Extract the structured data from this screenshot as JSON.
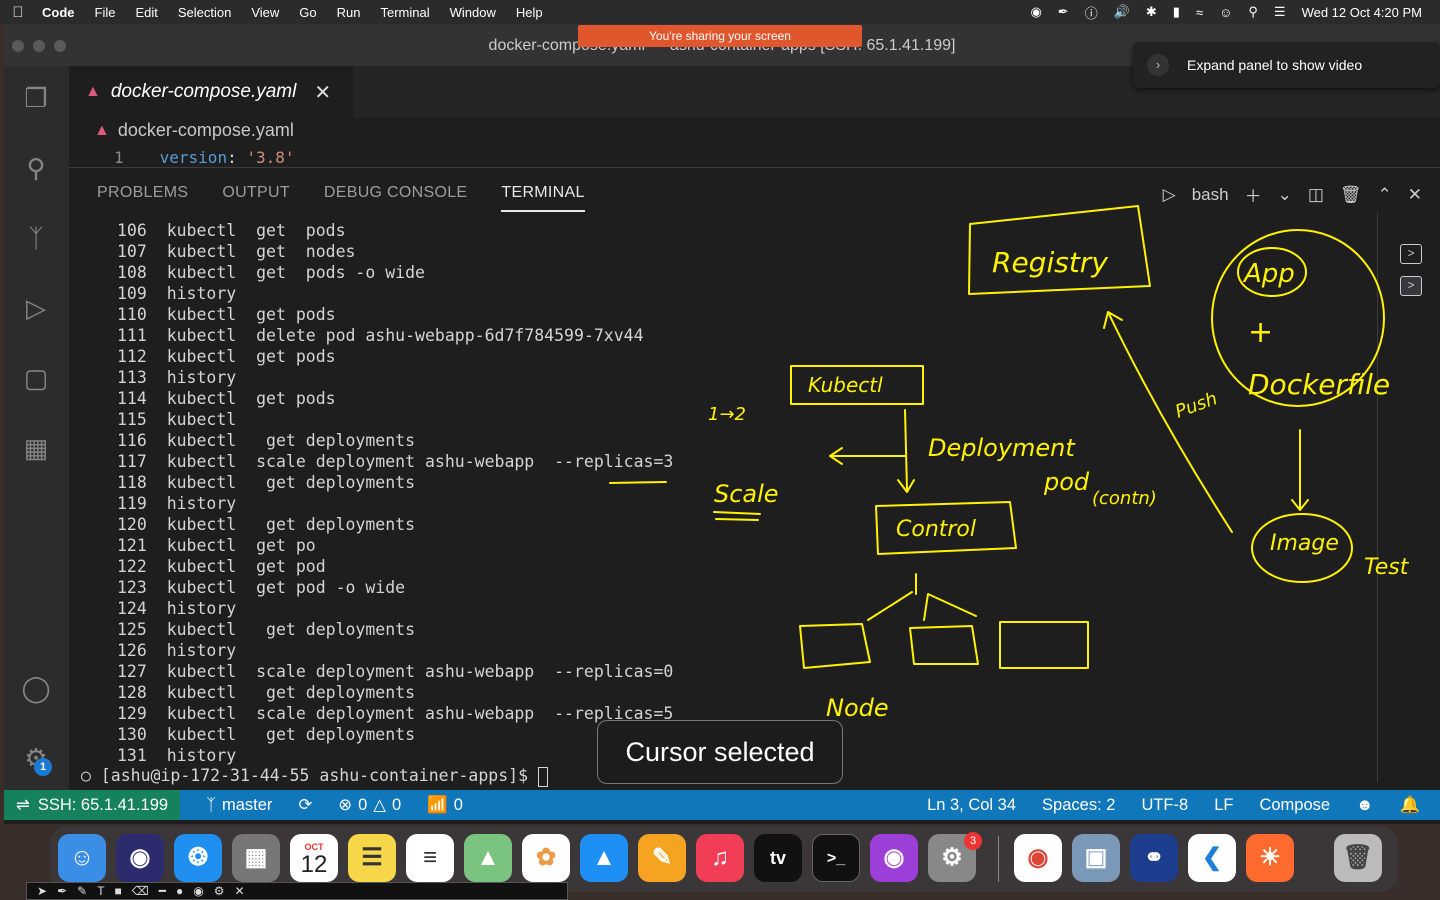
{
  "menubar": {
    "app": "Code",
    "items": [
      "File",
      "Edit",
      "Selection",
      "View",
      "Go",
      "Run",
      "Terminal",
      "Window",
      "Help"
    ],
    "datetime": "Wed 12 Oct  4:20 PM"
  },
  "share_banner": "You're sharing your screen",
  "window": {
    "title": "docker-compose.yaml — ashu-container-apps [SSH: 65.1.41.199]"
  },
  "expand_panel": "Expand panel to show video",
  "editor": {
    "tab_label": "docker-compose.yaml",
    "breadcrumb": "docker-compose.yaml",
    "line_number": "1",
    "key": "version",
    "colon": ": ",
    "value": "'3.8'"
  },
  "panel": {
    "tabs": [
      "PROBLEMS",
      "OUTPUT",
      "DEBUG CONSOLE",
      "TERMINAL"
    ],
    "active_tab": "TERMINAL",
    "shell": "bash"
  },
  "terminal": {
    "history": [
      {
        "n": "106",
        "cmd": "kubectl  get  pods"
      },
      {
        "n": "107",
        "cmd": "kubectl  get  nodes"
      },
      {
        "n": "108",
        "cmd": "kubectl  get  pods -o wide"
      },
      {
        "n": "109",
        "cmd": "history"
      },
      {
        "n": "110",
        "cmd": "kubectl  get pods"
      },
      {
        "n": "111",
        "cmd": "kubectl  delete pod ashu-webapp-6d7f784599-7xv44"
      },
      {
        "n": "112",
        "cmd": "kubectl  get pods"
      },
      {
        "n": "113",
        "cmd": "history"
      },
      {
        "n": "114",
        "cmd": "kubectl  get pods"
      },
      {
        "n": "115",
        "cmd": "kubectl"
      },
      {
        "n": "116",
        "cmd": "kubectl   get deployments"
      },
      {
        "n": "117",
        "cmd": "kubectl  scale deployment ashu-webapp  --replicas=3"
      },
      {
        "n": "118",
        "cmd": "kubectl   get deployments"
      },
      {
        "n": "119",
        "cmd": "history"
      },
      {
        "n": "120",
        "cmd": "kubectl   get deployments"
      },
      {
        "n": "121",
        "cmd": "kubectl  get po"
      },
      {
        "n": "122",
        "cmd": "kubectl  get pod"
      },
      {
        "n": "123",
        "cmd": "kubectl  get pod -o wide"
      },
      {
        "n": "124",
        "cmd": "history"
      },
      {
        "n": "125",
        "cmd": "kubectl   get deployments"
      },
      {
        "n": "126",
        "cmd": "history"
      },
      {
        "n": "127",
        "cmd": "kubectl  scale deployment ashu-webapp  --replicas=0"
      },
      {
        "n": "128",
        "cmd": "kubectl   get deployments"
      },
      {
        "n": "129",
        "cmd": "kubectl  scale deployment ashu-webapp  --replicas=5"
      },
      {
        "n": "130",
        "cmd": "kubectl   get deployments"
      },
      {
        "n": "131",
        "cmd": "history"
      }
    ],
    "prompt": "[ashu@ip-172-31-44-55 ashu-container-apps]$ "
  },
  "cursor_toast": "Cursor selected",
  "statusbar": {
    "remote": "SSH: 65.1.41.199",
    "branch": "master",
    "errors": "0",
    "warnings": "0",
    "ports": "0",
    "position": "Ln 3, Col 34",
    "spaces": "Spaces: 2",
    "encoding": "UTF-8",
    "eol": "LF",
    "language": "Compose"
  },
  "activity_badge": "1",
  "dock": {
    "calendar_month": "OCT",
    "calendar_day": "12",
    "settings_badge": "3"
  },
  "annotations": {
    "registry": "Registry",
    "kubectl": "Kubectl",
    "deployment": "Deployment",
    "pod": "pod",
    "contr": "(contn)",
    "control": "Control",
    "scale": "Scale",
    "push": "Push",
    "app": "App",
    "plus": "+",
    "dockerfile": "Dockerfile",
    "image": "Image",
    "test": "Test",
    "node": "Node",
    "one_to_two": "1→2"
  },
  "colors": {
    "statusbar": "#1177bb",
    "remote": "#16825d",
    "ink": "#fff200",
    "banner": "#e0562d"
  }
}
